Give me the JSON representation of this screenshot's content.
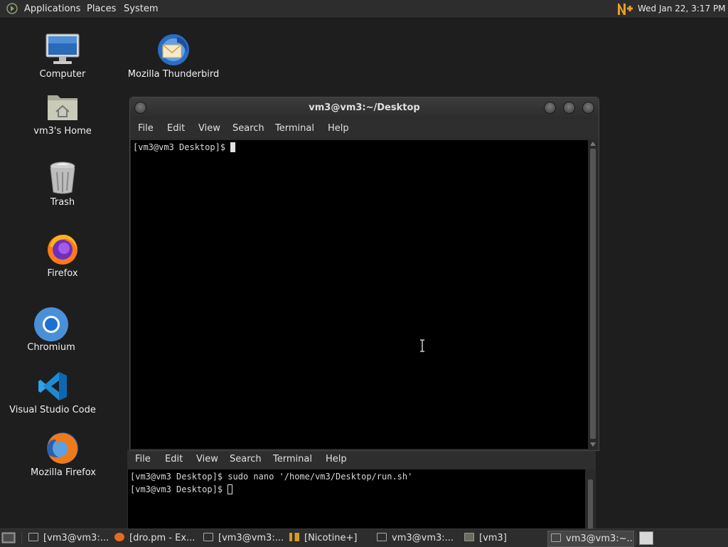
{
  "top_panel": {
    "menus": [
      "Applications",
      "Places",
      "System"
    ],
    "clock": "Wed Jan 22,  3:17 PM"
  },
  "desktop_icons": [
    {
      "label": "Computer",
      "icon": "computer-icon"
    },
    {
      "label": "Mozilla Thunderbird",
      "icon": "thunderbird-icon"
    },
    {
      "label": "vm3's Home",
      "icon": "home-folder-icon"
    },
    {
      "label": "Trash",
      "icon": "trash-icon"
    },
    {
      "label": "Firefox",
      "icon": "firefox-icon"
    },
    {
      "label": "Chromium",
      "icon": "chromium-icon"
    },
    {
      "label": "Visual Studio Code",
      "icon": "vscode-icon"
    },
    {
      "label": "Mozilla Firefox",
      "icon": "firefox-icon"
    }
  ],
  "terminal_main": {
    "title": "vm3@vm3:~/Desktop",
    "menus": [
      "File",
      "Edit",
      "View",
      "Search",
      "Terminal",
      "Help"
    ],
    "lines": [
      "[vm3@vm3 Desktop]$ "
    ]
  },
  "terminal_back": {
    "menus": [
      "File",
      "Edit",
      "View",
      "Search",
      "Terminal",
      "Help"
    ],
    "lines": [
      "[vm3@vm3 Desktop]$ sudo nano '/home/vm3/Desktop/run.sh'",
      "[vm3@vm3 Desktop]$ "
    ]
  },
  "taskbar": {
    "items": [
      {
        "label": "[vm3@vm3:...",
        "icon": "terminal-icon"
      },
      {
        "label": "[dro.pm - Ex...",
        "icon": "firefox-icon"
      },
      {
        "label": "[vm3@vm3:...",
        "icon": "terminal-icon"
      },
      {
        "label": "[Nicotine+]",
        "icon": "nicotine-icon"
      },
      {
        "label": "vm3@vm3:...",
        "icon": "terminal-icon"
      },
      {
        "label": "[vm3]",
        "icon": "folder-icon"
      },
      {
        "label": "vm3@vm3:~...",
        "icon": "terminal-icon"
      }
    ]
  },
  "colors": {
    "panel": "#2d2d2d",
    "desktop": "#1e1e1e",
    "terminal_bg": "#000000"
  }
}
